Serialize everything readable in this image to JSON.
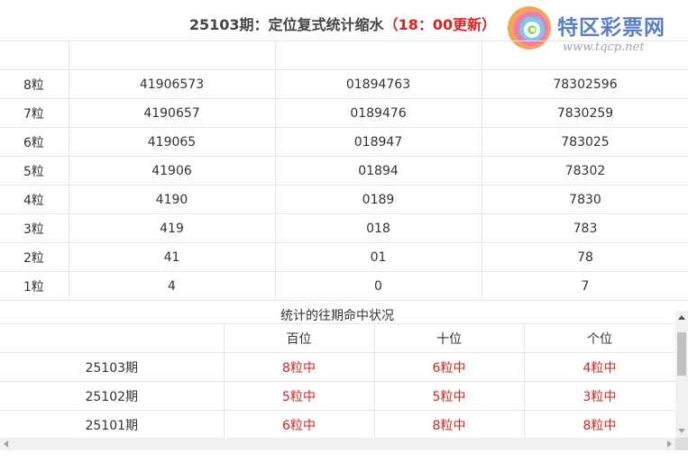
{
  "header": {
    "title_prefix": "25103期：定位复式统计缩水",
    "title_time": "（18：00更新）"
  },
  "logo": {
    "name": "特区彩票网",
    "url": "www.tqcp.net"
  },
  "stats_table": {
    "headers": [
      "",
      "",
      "",
      ""
    ],
    "rows": [
      [
        "8粒",
        "41906573",
        "01894763",
        "78302596"
      ],
      [
        "7粒",
        "4190657",
        "0189476",
        "7830259"
      ],
      [
        "6粒",
        "419065",
        "018947",
        "783025"
      ],
      [
        "5粒",
        "41906",
        "01894",
        "78302"
      ],
      [
        "4粒",
        "4190",
        "0189",
        "7830"
      ],
      [
        "3粒",
        "419",
        "018",
        "783"
      ],
      [
        "2粒",
        "41",
        "01",
        "78"
      ],
      [
        "1粒",
        "4",
        "0",
        "7"
      ]
    ]
  },
  "history": {
    "section_title": "统计的往期命中状况",
    "headers": [
      "",
      "百位",
      "十位",
      "个位"
    ],
    "rows": [
      [
        "25103期",
        "8粒中",
        "6粒中",
        "4粒中"
      ],
      [
        "25102期",
        "5粒中",
        "5粒中",
        "3粒中"
      ],
      [
        "25101期",
        "6粒中",
        "8粒中",
        "8粒中"
      ]
    ]
  },
  "colors": {
    "accent_red": "#e02020",
    "border": "#e6e6e6",
    "logo_blue": "#5a7fc6"
  }
}
